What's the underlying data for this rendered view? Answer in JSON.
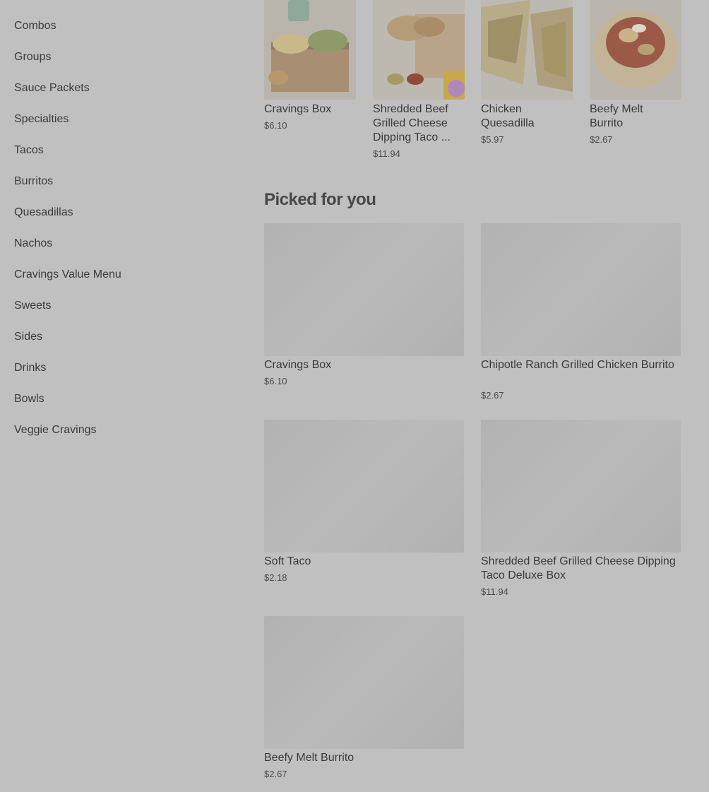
{
  "sidebar": {
    "categories": [
      "Combos",
      "Groups",
      "Sauce Packets",
      "Specialties",
      "Tacos",
      "Burritos",
      "Quesadillas",
      "Nachos",
      "Cravings Value Menu",
      "Sweets",
      "Sides",
      "Drinks",
      "Bowls",
      "Veggie Cravings"
    ]
  },
  "featured": [
    {
      "name": "Cravings Box",
      "price": "$6.10"
    },
    {
      "name": "Shredded Beef Grilled Cheese Dipping Taco ...",
      "price": "$11.94"
    },
    {
      "name": "Chicken Quesadilla",
      "price": "$5.97"
    },
    {
      "name": "Beefy Melt Burrito",
      "price": "$2.67"
    }
  ],
  "picked": {
    "title": "Picked for you",
    "items": [
      {
        "name": "Cravings Box",
        "price": "$6.10"
      },
      {
        "name": "Chipotle Ranch Grilled Chicken Burrito",
        "price": "$2.67"
      },
      {
        "name": "Soft Taco",
        "price": "$2.18"
      },
      {
        "name": "Shredded Beef Grilled Cheese Dipping Taco Deluxe Box",
        "price": "$11.94"
      },
      {
        "name": "Beefy Melt Burrito",
        "price": "$2.67"
      }
    ]
  },
  "colors": {
    "overlay_background": "#c0c0c0",
    "text": "#3a3a3a",
    "placeholder": "#b4b4b4"
  }
}
